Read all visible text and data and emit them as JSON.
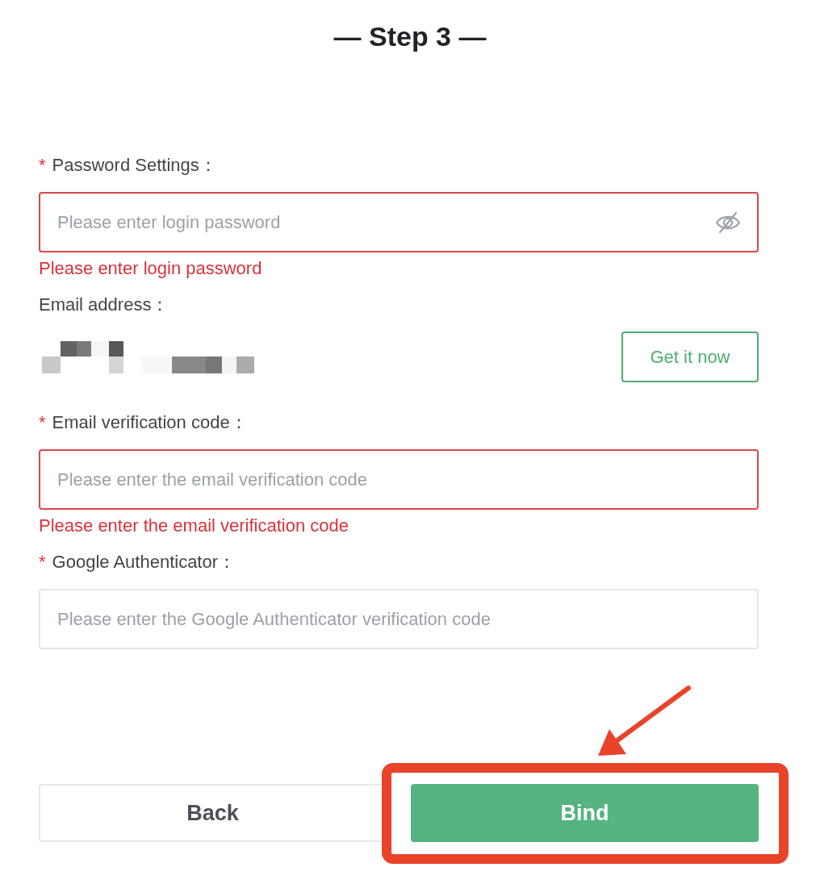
{
  "title": "— Step 3 —",
  "fields": [
    {
      "kind": "password",
      "required_mark": "*",
      "label": "Password Settings：",
      "placeholder": "Please enter login password",
      "password_visible": false,
      "error": "Please enter login password"
    },
    {
      "kind": "email",
      "label": "Email address：",
      "action": "Get it now"
    },
    {
      "kind": "text",
      "required_mark": "*",
      "label": "Email verification code：",
      "placeholder": "Please enter the email verification code",
      "error": "Please enter the email verification code"
    },
    {
      "kind": "text",
      "required_mark": "*",
      "label": "Google Authenticator：",
      "placeholder": "Please enter the Google Authenticator verification code"
    }
  ],
  "buttons": [
    {
      "label": "Back",
      "kind": "secondary",
      "highlighted": false
    },
    {
      "label": "Bind",
      "kind": "primary",
      "highlighted": true
    }
  ]
}
